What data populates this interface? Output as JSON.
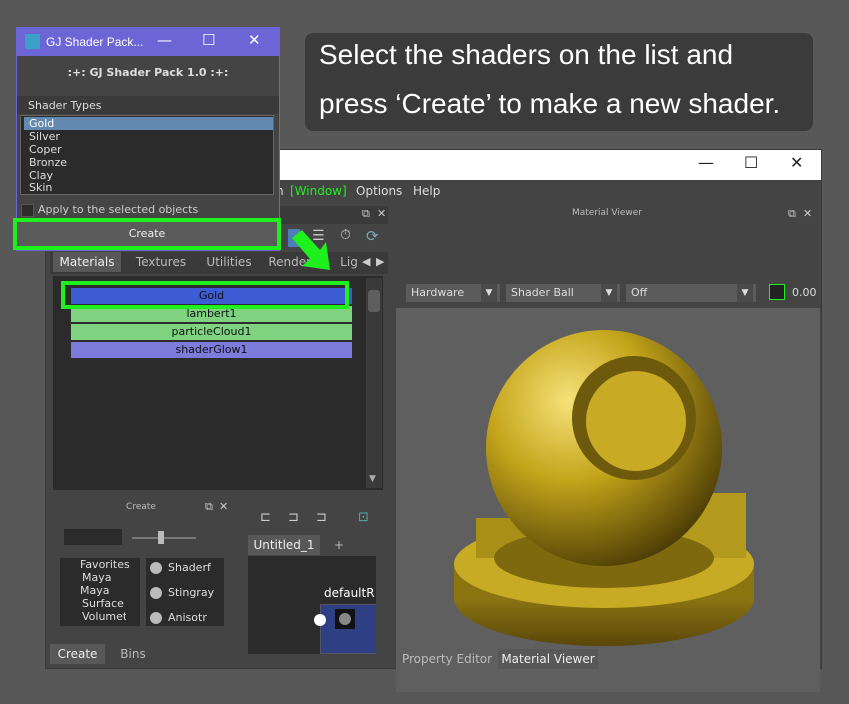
{
  "tooltip": {
    "line1": "Select the shaders on the list and",
    "line2": "press ‘Create’ to make a new shader."
  },
  "hypershade": {
    "window_buttons": {
      "minimize": "—",
      "maximize": "☐",
      "close": "✕"
    },
    "menu": {
      "partial": "n",
      "window": "[Window]",
      "options": "Options",
      "help": "Help"
    },
    "browser_tabs": [
      "Materials",
      "Textures",
      "Utilities",
      "Rendering",
      "Lig"
    ],
    "materials": [
      {
        "name": "Gold",
        "color": "#3d5cd4"
      },
      {
        "name": "lambert1",
        "color": "#7fd27f"
      },
      {
        "name": "particleCloud1",
        "color": "#7fd27f"
      },
      {
        "name": "shaderGlow1",
        "color": "#7d7bdb"
      }
    ],
    "create_panel": {
      "title": "Create",
      "tree": [
        "Favorites",
        "Maya",
        "Maya",
        "Surface",
        "Volumet"
      ],
      "items": [
        "Shaderf",
        "Stingray",
        "Anisotr"
      ],
      "tabs": [
        "Create",
        "Bins"
      ]
    },
    "graph": {
      "tab": "Untitled_1",
      "add_tab": "+",
      "node": "defaultR"
    },
    "viewer": {
      "title": "Material Viewer",
      "renderer": "Hardware",
      "geometry": "Shader Ball",
      "env": "Off",
      "exposure": "0.00",
      "tabs": [
        "Property Editor",
        "Material Viewer"
      ]
    }
  },
  "gj_dialog": {
    "title": "GJ Shader Pack...",
    "header": ":+:  GJ Shader Pack 1.0  :+:",
    "section_label": "Shader Types",
    "shader_types": [
      "Gold",
      "Silver",
      "Coper",
      "Bronze",
      "Clay",
      "Skin"
    ],
    "selected": "Gold",
    "apply_label": "Apply to the selected objects",
    "create_label": "Create"
  },
  "colors": {
    "highlight": "#1ef01e",
    "gj_title": "#6c65d6",
    "gold": "#c4a51a"
  }
}
